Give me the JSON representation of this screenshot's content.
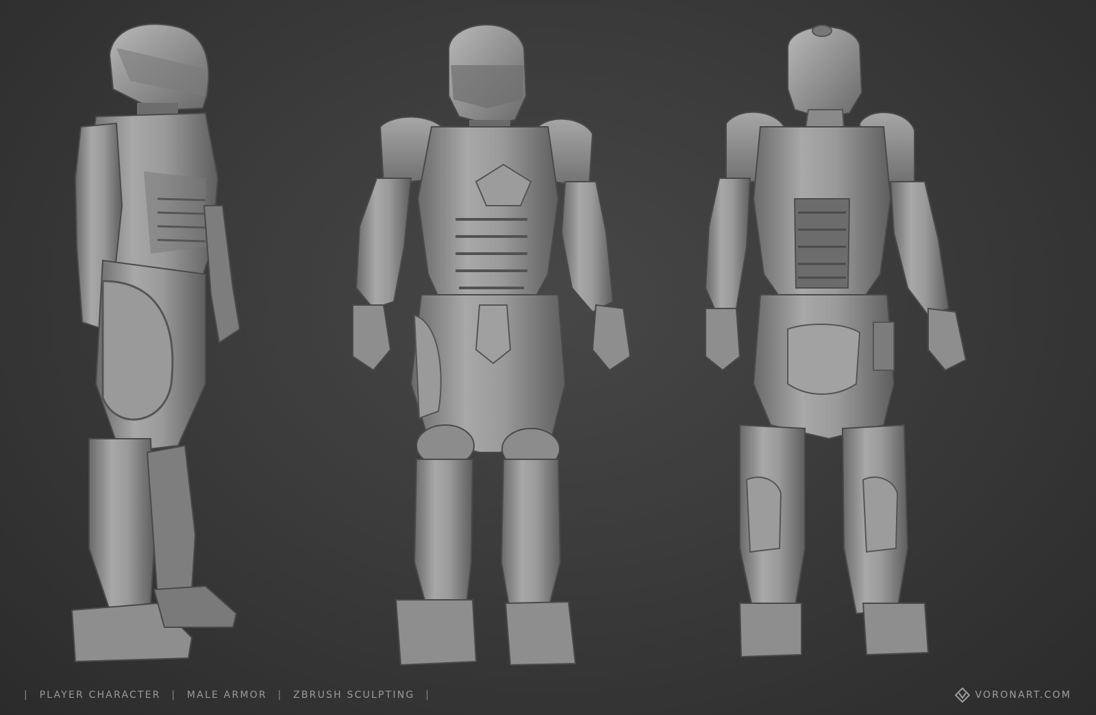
{
  "caption": {
    "leading_sep": "|",
    "items": [
      "PLAYER CHARACTER",
      "MALE ARMOR",
      "ZBRUSH SCULPTING"
    ],
    "separator": "|"
  },
  "brand": {
    "text": "VORONART.COM"
  },
  "views": [
    {
      "name": "side-view",
      "facing": "three-quarter left"
    },
    {
      "name": "front-view",
      "facing": "front"
    },
    {
      "name": "back-view",
      "facing": "back"
    }
  ],
  "colors": {
    "background": "#3b3b3b",
    "model": "#8c8c8c",
    "model_light": "#b5b5b5",
    "model_dark": "#5a5a5a",
    "caption": "#9a9a9a"
  }
}
